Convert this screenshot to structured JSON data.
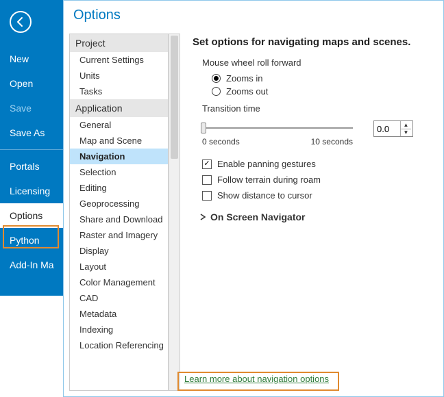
{
  "backstage": {
    "items": [
      "New",
      "Open",
      "Save",
      "Save As",
      "Portals",
      "Licensing",
      "Options",
      "Python",
      "Add-In Ma"
    ],
    "disabled": [
      "Save"
    ],
    "active": "Options"
  },
  "dialog": {
    "title": "Options",
    "categories": {
      "project_header": "Project",
      "project": [
        "Current Settings",
        "Units",
        "Tasks"
      ],
      "application_header": "Application",
      "application": [
        "General",
        "Map and Scene",
        "Navigation",
        "Selection",
        "Editing",
        "Geoprocessing",
        "Share and Download",
        "Raster and Imagery",
        "Display",
        "Layout",
        "Color Management",
        "CAD",
        "Metadata",
        "Indexing",
        "Location Referencing"
      ],
      "active": "Navigation"
    },
    "pane": {
      "heading": "Set options for navigating maps and scenes.",
      "wheel_label": "Mouse wheel roll forward",
      "wheel_opts": [
        "Zooms in",
        "Zooms out"
      ],
      "wheel_selected": "Zooms in",
      "transition_label": "Transition time",
      "slider_min_label": "0 seconds",
      "slider_max_label": "10 seconds",
      "transition_value": "0.0",
      "check_pan": "Enable panning gestures",
      "check_terrain": "Follow terrain during roam",
      "check_cursor": "Show distance to cursor",
      "checks": {
        "pan": true,
        "terrain": false,
        "cursor": false
      },
      "group": "On Screen Navigator",
      "learn": "Learn more about navigation options"
    }
  }
}
